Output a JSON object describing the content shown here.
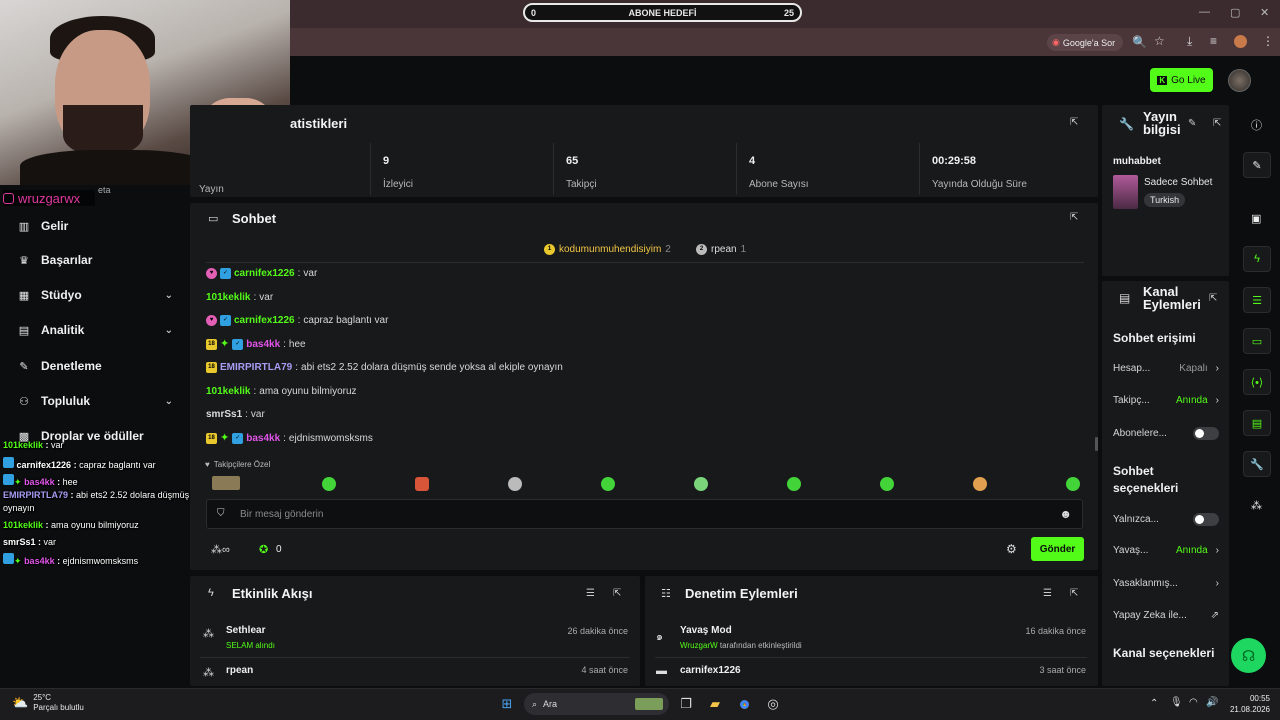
{
  "goal": {
    "left": "0",
    "title": "ABONE HEDEFİ",
    "right": "25"
  },
  "browser": {
    "google_chip": "Google'a Sor"
  },
  "header": {
    "go_live": "Go Live"
  },
  "instagram": {
    "handle": "wruzgarwx"
  },
  "sidebar": {
    "partial_label": "eta",
    "items": [
      {
        "label": "Gelir",
        "icon": "dollar-icon"
      },
      {
        "label": "Başarılar",
        "icon": "trophy-icon"
      },
      {
        "label": "Stüdyo",
        "icon": "studio-icon"
      },
      {
        "label": "Analitik",
        "icon": "chart-icon"
      },
      {
        "label": "Denetleme",
        "icon": "wrench-icon"
      },
      {
        "label": "Topluluk",
        "icon": "people-icon"
      },
      {
        "label": "Droplar ve ödüller",
        "icon": "gift-icon"
      }
    ]
  },
  "overlay_chat": [
    {
      "user": "101keklik",
      "text": "var"
    },
    {
      "user": "carnifex1226",
      "text": "capraz baglantı var"
    },
    {
      "user": "bas4kk",
      "text": "hee"
    },
    {
      "user": "EMIRPIRTLA79",
      "text": "abi ets2 2.52 dolara düşmüş sende yoksa al ekiple"
    },
    {
      "user": "",
      "text": "oynayın"
    },
    {
      "user": "101keklik",
      "text": "ama oyunu bilmiyoruz"
    },
    {
      "user": "smrSs1",
      "text": "var"
    },
    {
      "user": "bas4kk",
      "text": "ejdnismwomsksms"
    }
  ],
  "stats": {
    "title_partial": "atistikleri",
    "first_label": "Yayın",
    "cells": [
      {
        "value": "9",
        "label": "İzleyici"
      },
      {
        "value": "65",
        "label": "Takipçi"
      },
      {
        "value": "4",
        "label": "Abone Sayısı"
      },
      {
        "value": "00:29:58",
        "label": "Yayında Olduğu Süre"
      }
    ]
  },
  "chat": {
    "title": "Sohbet",
    "top_gifters": [
      {
        "rank": "1",
        "name": "kodumunmuhendisiyim",
        "count": "2"
      },
      {
        "rank": "2",
        "name": "rpean",
        "count": "1"
      }
    ],
    "messages": [
      {
        "user": "carnifex1226",
        "text": "var"
      },
      {
        "user": "101keklik",
        "text": "var"
      },
      {
        "user": "carnifex1226",
        "text": "capraz baglantı var"
      },
      {
        "user": "bas4kk",
        "text": "hee"
      },
      {
        "user": "EMIRPIRTLA79",
        "text": "abi ets2 2.52 dolara düşmüş sende yoksa al ekiple oynayın"
      },
      {
        "user": "101keklik",
        "text": "ama oyunu bilmiyoruz"
      },
      {
        "user": "smrSs1",
        "text": "var"
      },
      {
        "user": "bas4kk",
        "text": "ejdnismwomsksms"
      }
    ],
    "emote_section": "Takipçilere Özel",
    "input_placeholder": "Bir mesaj gönderin",
    "points": "0",
    "send": "Gönder"
  },
  "activity": {
    "title": "Etkinlik Akışı",
    "items": [
      {
        "name": "Sethlear",
        "sub": "SELAM alındı",
        "time": "26 dakika önce"
      },
      {
        "name": "rpean",
        "sub": "",
        "time": "4 saat önce"
      }
    ]
  },
  "moderation": {
    "title": "Denetim Eylemleri",
    "items": [
      {
        "name": "Yavaş Mod",
        "sub_user": "WruzgarW",
        "sub_text": "tarafından etkinleştirildi",
        "time": "16 dakika önce"
      },
      {
        "name": "carnifex1226",
        "time": "3 saat önce"
      }
    ]
  },
  "stream_info": {
    "title_line1": "Yayın",
    "title_line2": "bilgisi",
    "stream_title": "muhabbet",
    "category": "Sadece Sohbet",
    "language": "Turkish"
  },
  "channel_actions": {
    "title_line1": "Kanal",
    "title_line2": "Eylemleri",
    "chat_access": "Sohbet erişimi",
    "rows1": [
      {
        "label": "Hesap...",
        "value": "Kapalı",
        "type": "chevron"
      },
      {
        "label": "Takipç...",
        "value": "Anında",
        "type": "chevron"
      },
      {
        "label": "Abonelere...",
        "value": "",
        "type": "toggle"
      }
    ],
    "chat_options_line1": "Sohbet",
    "chat_options_line2": "seçenekleri",
    "rows2": [
      {
        "label": "Yalnızca...",
        "value": "",
        "type": "toggle"
      },
      {
        "label": "Yavaş...",
        "value": "Anında",
        "type": "chevron"
      },
      {
        "label": "Yasaklanmış...",
        "value": "",
        "type": "chevron"
      },
      {
        "label": "Yapay Zeka ile...",
        "value": "",
        "type": "external"
      }
    ],
    "channel_options": "Kanal seçenekleri"
  },
  "taskbar": {
    "temp": "25°C",
    "weather": "Parçalı bulutlu",
    "search": "Ara",
    "time": "00:55",
    "date": "21.08.2026"
  }
}
